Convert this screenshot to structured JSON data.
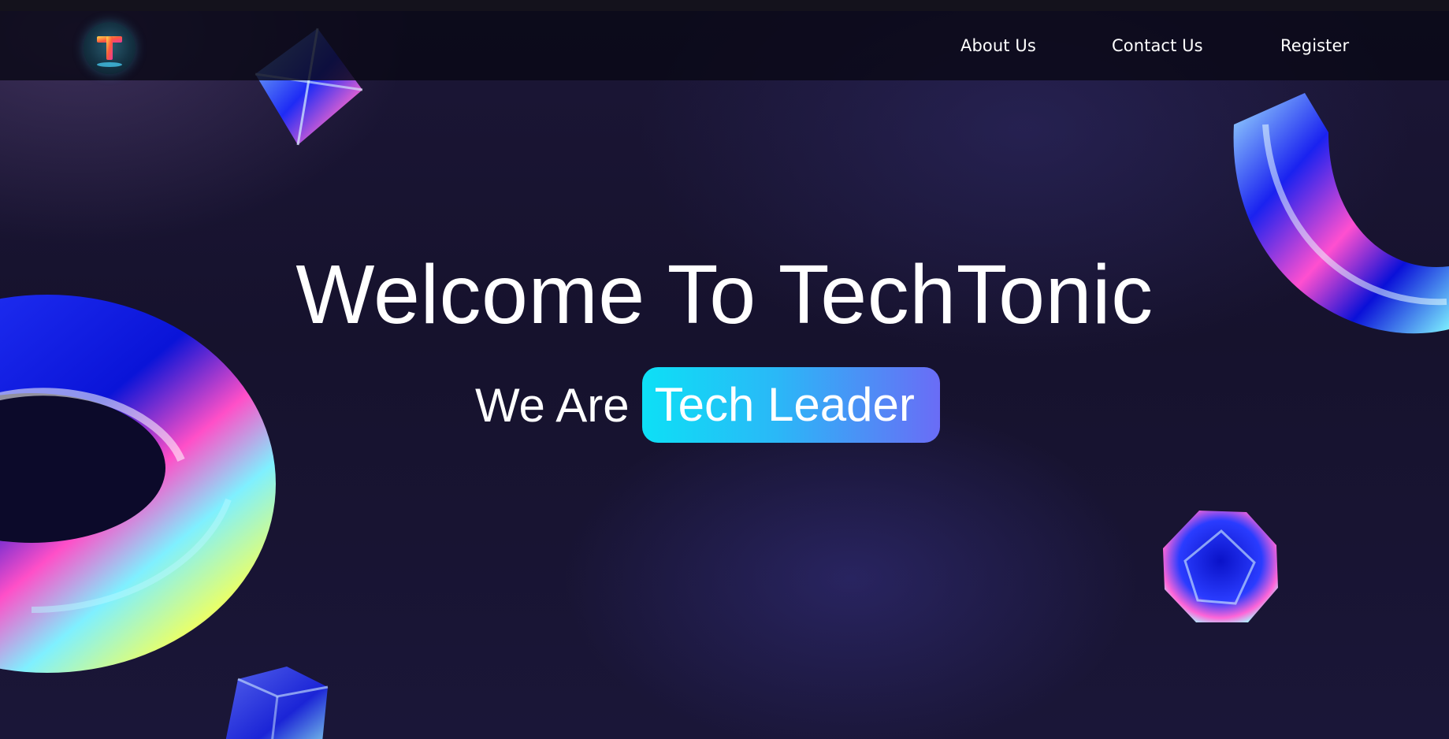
{
  "brand": {
    "logo_icon": "techtonic-logo-icon",
    "logo_letter": "T"
  },
  "nav": {
    "items": [
      {
        "label": "About Us"
      },
      {
        "label": "Contact Us"
      },
      {
        "label": "Register"
      }
    ]
  },
  "hero": {
    "title": "Welcome To TechTonic",
    "subtitle_prefix": "We Are",
    "subtitle_highlight": "Tech Leader"
  },
  "colors": {
    "background": "#16122d",
    "navbar": "#0a0916",
    "text": "#ffffff",
    "highlight_start": "#0de0f6",
    "highlight_end": "#6a6cf6"
  },
  "decorations": [
    "octahedron-crystal-icon",
    "torus-ring-icon",
    "half-ring-icon",
    "gem-crystal-icon",
    "cube-crystal-icon"
  ]
}
